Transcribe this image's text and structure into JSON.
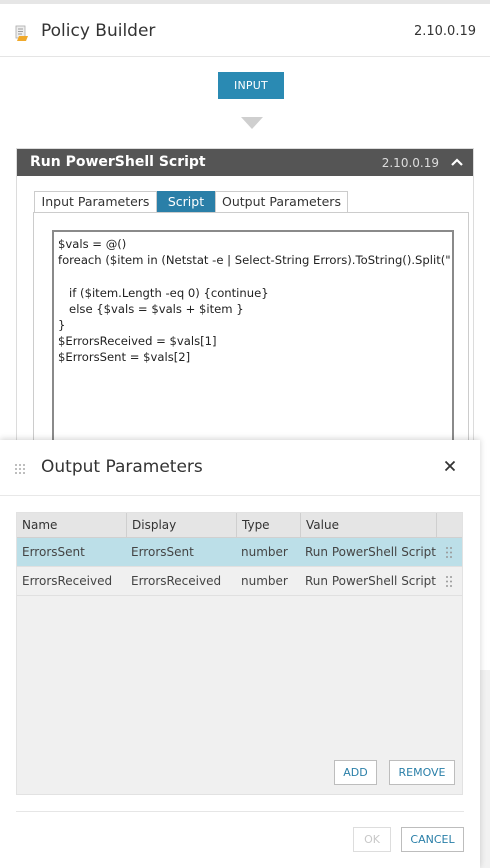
{
  "app": {
    "title": "Policy Builder",
    "version": "2.10.0.19"
  },
  "flow": {
    "input_label": "INPUT"
  },
  "activity": {
    "name": "Run PowerShell Script",
    "version": "2.10.0.19",
    "tabs": [
      {
        "label": "Input Parameters",
        "active": false
      },
      {
        "label": "Script",
        "active": true
      },
      {
        "label": "Output Parameters",
        "active": false
      }
    ],
    "script": "$vals = @()\nforeach ($item in (Netstat -e | Select-String Errors).ToString().Split(\" \"))\n\n   if ($item.Length -eq 0) {continue}\n   else {$vals = $vals + $item }\n}\n$ErrorsReceived = $vals[1]\n$ErrorsSent = $vals[2]"
  },
  "modal": {
    "title": "Output Parameters",
    "columns": [
      "Name",
      "Display",
      "Type",
      "Value"
    ],
    "rows": [
      {
        "name": "ErrorsSent",
        "display": "ErrorsSent",
        "type": "number",
        "value": "Run PowerShell Script.Ei",
        "selected": true
      },
      {
        "name": "ErrorsReceived",
        "display": "ErrorsReceived",
        "type": "number",
        "value": "Run PowerShell Script.Ei",
        "selected": false
      }
    ],
    "add_label": "ADD",
    "remove_label": "REMOVE",
    "ok_label": "OK",
    "cancel_label": "CANCEL"
  },
  "colors": {
    "accent": "#2a8ab3",
    "tab_active": "#2a7fa8",
    "header_dark": "#555555",
    "row_selected": "#bcdfe8"
  },
  "icons": {
    "logo": "policy-document-icon",
    "collapse": "chevron-up-icon",
    "drag": "drag-grip-icon",
    "close": "close-icon",
    "row_handle": "row-drag-handle-icon"
  }
}
